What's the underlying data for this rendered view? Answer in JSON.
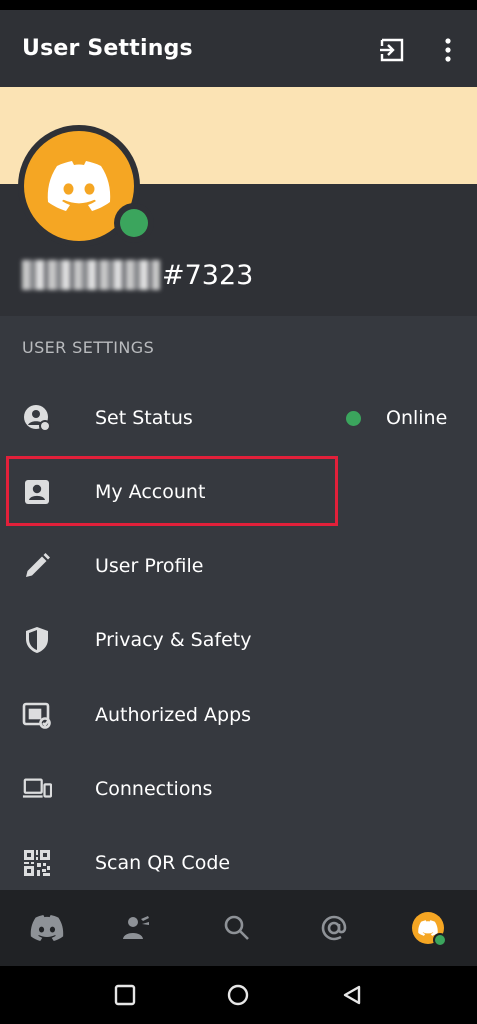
{
  "header": {
    "title": "User Settings"
  },
  "profile": {
    "username_tag": "#7323"
  },
  "section_title": "USER SETTINGS",
  "status": {
    "label": "Online",
    "color": "#3ba55d"
  },
  "menu": [
    {
      "label": "Set Status",
      "icon": "set-status-icon"
    },
    {
      "label": "My Account",
      "icon": "account-icon"
    },
    {
      "label": "User Profile",
      "icon": "pencil-icon"
    },
    {
      "label": "Privacy & Safety",
      "icon": "shield-icon"
    },
    {
      "label": "Authorized Apps",
      "icon": "authorized-apps-icon"
    },
    {
      "label": "Connections",
      "icon": "devices-icon"
    },
    {
      "label": "Scan QR Code",
      "icon": "qr-code-icon"
    }
  ],
  "bottom_nav": [
    "home-icon",
    "friends-icon",
    "search-icon",
    "mentions-icon",
    "profile-avatar"
  ],
  "colors": {
    "accent": "#f5a623",
    "banner": "#fbe3b4",
    "highlight": "#e2203a",
    "online": "#3ba55d"
  }
}
